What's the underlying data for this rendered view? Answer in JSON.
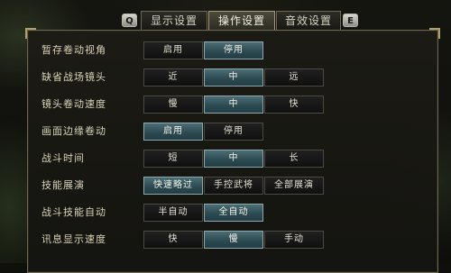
{
  "tabs": {
    "left_key": "Q",
    "right_key": "E",
    "items": [
      {
        "label": "显示设置",
        "active": false
      },
      {
        "label": "操作设置",
        "active": true
      },
      {
        "label": "音效设置",
        "active": false
      }
    ]
  },
  "settings": [
    {
      "label": "暂存卷动视角",
      "options": [
        "启用",
        "停用"
      ],
      "selected": 1
    },
    {
      "label": "缺省战场镜头",
      "options": [
        "近",
        "中",
        "远"
      ],
      "selected": 1
    },
    {
      "label": "镜头卷动速度",
      "options": [
        "慢",
        "中",
        "快"
      ],
      "selected": 1
    },
    {
      "label": "画面边缘卷动",
      "options": [
        "启用",
        "停用"
      ],
      "selected": 0
    },
    {
      "label": "战斗时间",
      "options": [
        "短",
        "中",
        "长"
      ],
      "selected": 1
    },
    {
      "label": "技能展演",
      "options": [
        "快速略过",
        "手控武将",
        "全部展演"
      ],
      "selected": 0
    },
    {
      "label": "战斗技能自动",
      "options": [
        "半自动",
        "全自动"
      ],
      "selected": 1
    },
    {
      "label": "讯息显示速度",
      "options": [
        "快",
        "慢",
        "手动"
      ],
      "selected": 1
    }
  ],
  "colors": {
    "selected_button": "#2c4b52",
    "unselected_button": "#151515",
    "label_text": "#d9d3b8",
    "panel_border": "#6e6852"
  }
}
